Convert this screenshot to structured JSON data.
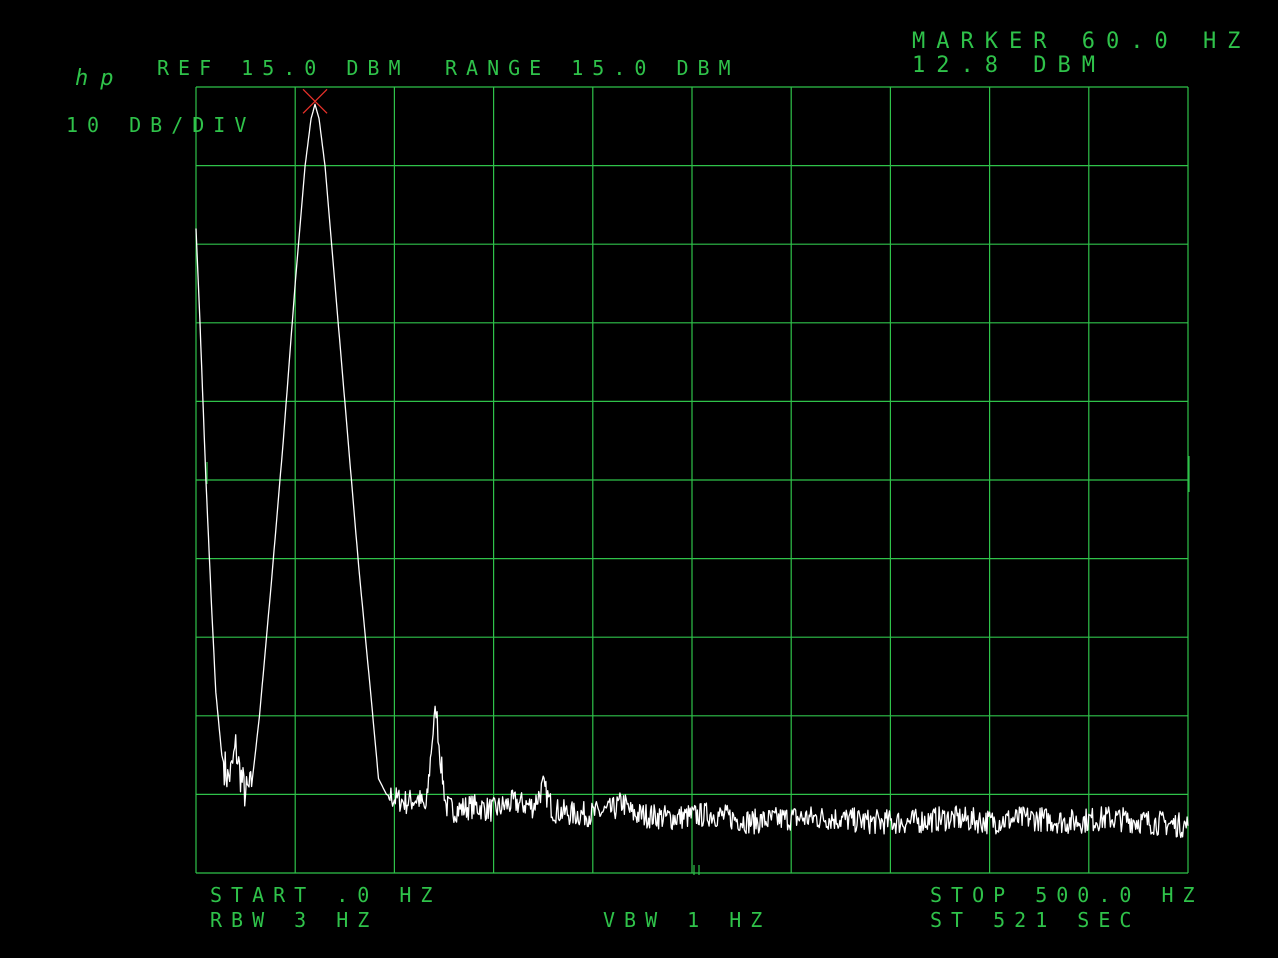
{
  "header": {
    "logo": "hp",
    "ref": "REF 15.0 DBM",
    "range": "RANGE 15.0 DBM",
    "scale": "10 DB/DIV",
    "marker_freq": "MARKER 60.0 HZ",
    "marker_level": "12.8 DBM"
  },
  "footer": {
    "start": "START .0 HZ",
    "rbw": "RBW 3 HZ",
    "vbw": "VBW 1 HZ",
    "stop": "STOP 500.0 HZ",
    "sweep": "ST 521 SEC"
  },
  "colors": {
    "grid": "#2fc24a",
    "text": "#2fc24a",
    "trace": "#ffffff",
    "marker": "#e8312a",
    "background": "#000000"
  },
  "chart_data": {
    "type": "line",
    "xlim": [
      0,
      500
    ],
    "ylim": [
      -85,
      15
    ],
    "x_unit": "HZ",
    "y_unit": "DBM",
    "grid": true,
    "marker": {
      "x": 60,
      "y": 12.8
    },
    "series": [
      {
        "points": [
          [
            0,
            -3
          ],
          [
            2,
            -15
          ],
          [
            5,
            -35
          ],
          [
            8,
            -52
          ],
          [
            10,
            -62
          ],
          [
            13,
            -70
          ],
          [
            16,
            -73
          ],
          [
            18,
            -72
          ],
          [
            20,
            -69
          ],
          [
            22,
            -72
          ],
          [
            25,
            -75
          ],
          [
            28,
            -74
          ],
          [
            32,
            -65
          ],
          [
            38,
            -48
          ],
          [
            44,
            -30
          ],
          [
            50,
            -10
          ],
          [
            55,
            5
          ],
          [
            58,
            11
          ],
          [
            60,
            12.8
          ],
          [
            62,
            11
          ],
          [
            65,
            5
          ],
          [
            70,
            -10
          ],
          [
            76,
            -28
          ],
          [
            82,
            -46
          ],
          [
            88,
            -62
          ],
          [
            92,
            -73
          ],
          [
            96,
            -75
          ],
          [
            100,
            -75.5
          ],
          [
            106,
            -76
          ],
          [
            112,
            -75.5
          ],
          [
            116,
            -77
          ],
          [
            119,
            -68
          ],
          [
            121,
            -64
          ],
          [
            123,
            -70
          ],
          [
            126,
            -76.5
          ],
          [
            130,
            -77
          ],
          [
            140,
            -76.5
          ],
          [
            150,
            -77
          ],
          [
            160,
            -76
          ],
          [
            170,
            -76.5
          ],
          [
            175,
            -74
          ],
          [
            180,
            -77
          ],
          [
            190,
            -77.5
          ],
          [
            200,
            -77.5
          ],
          [
            210,
            -77
          ],
          [
            215,
            -76
          ],
          [
            220,
            -77.5
          ],
          [
            240,
            -78
          ],
          [
            260,
            -77.5
          ],
          [
            280,
            -78.5
          ],
          [
            300,
            -78
          ],
          [
            320,
            -78
          ],
          [
            340,
            -78.5
          ],
          [
            360,
            -78.5
          ],
          [
            380,
            -78
          ],
          [
            400,
            -78.5
          ],
          [
            420,
            -78
          ],
          [
            440,
            -78.5
          ],
          [
            460,
            -78
          ],
          [
            480,
            -78.5
          ],
          [
            500,
            -79
          ]
        ]
      }
    ]
  }
}
